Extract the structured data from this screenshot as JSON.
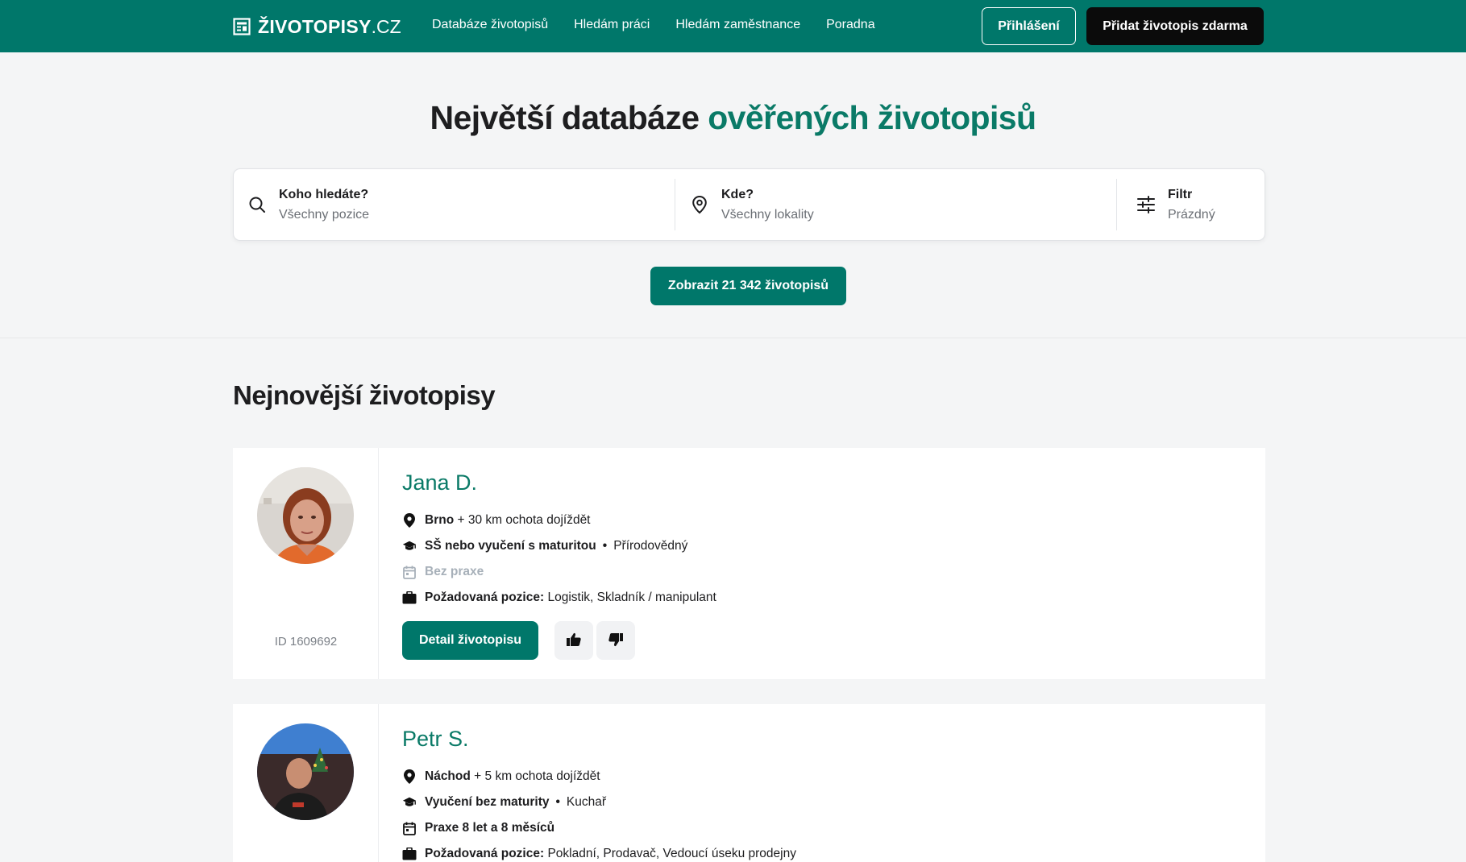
{
  "header": {
    "logo_main": "ŽIVOTOPISY",
    "logo_tld": ".CZ",
    "nav": [
      {
        "label": "Databáze životopisů"
      },
      {
        "label": "Hledám práci"
      },
      {
        "label": "Hledám zaměstnance"
      },
      {
        "label": "Poradna"
      }
    ],
    "login_label": "Přihlášení",
    "add_cv_label": "Přidat životopis zdarma"
  },
  "hero": {
    "title_prefix": "Největší databáze ",
    "title_accent": "ověřených životopisů",
    "search": {
      "who_label": "Koho hledáte?",
      "who_value": "Všechny pozice",
      "where_label": "Kde?",
      "where_value": "Všechny lokality",
      "filter_label": "Filtr",
      "filter_value": "Prázdný"
    },
    "show_button": "Zobrazit 21 342 životopisů"
  },
  "list": {
    "title": "Nejnovější životopisy",
    "cards": [
      {
        "name": "Jana D.",
        "id": "ID 1609692",
        "city": "Brno",
        "commute": "+ 30 km ochota dojíždět",
        "education": "SŠ nebo vyučení s maturitou",
        "sep": "•",
        "field": "Přírodovědný",
        "experience": "Bez praxe",
        "position_label": "Požadovaná pozice:",
        "positions": "Logistik, Skladník / manipulant",
        "detail_label": "Detail životopisu"
      },
      {
        "name": "Petr S.",
        "city": "Náchod",
        "commute": "+ 5 km ochota dojíždět",
        "education": "Vyučení bez maturity",
        "sep": "•",
        "field": "Kuchař",
        "experience": "Praxe 8 let a 8 měsíců",
        "position_label": "Požadovaná pozice:",
        "positions": "Pokladní, Prodavač, Vedoucí úseku prodejny"
      }
    ]
  },
  "colors": {
    "brand": "#00776a",
    "accent_text": "#0a7a67",
    "dark_button": "#0b0b0b"
  }
}
